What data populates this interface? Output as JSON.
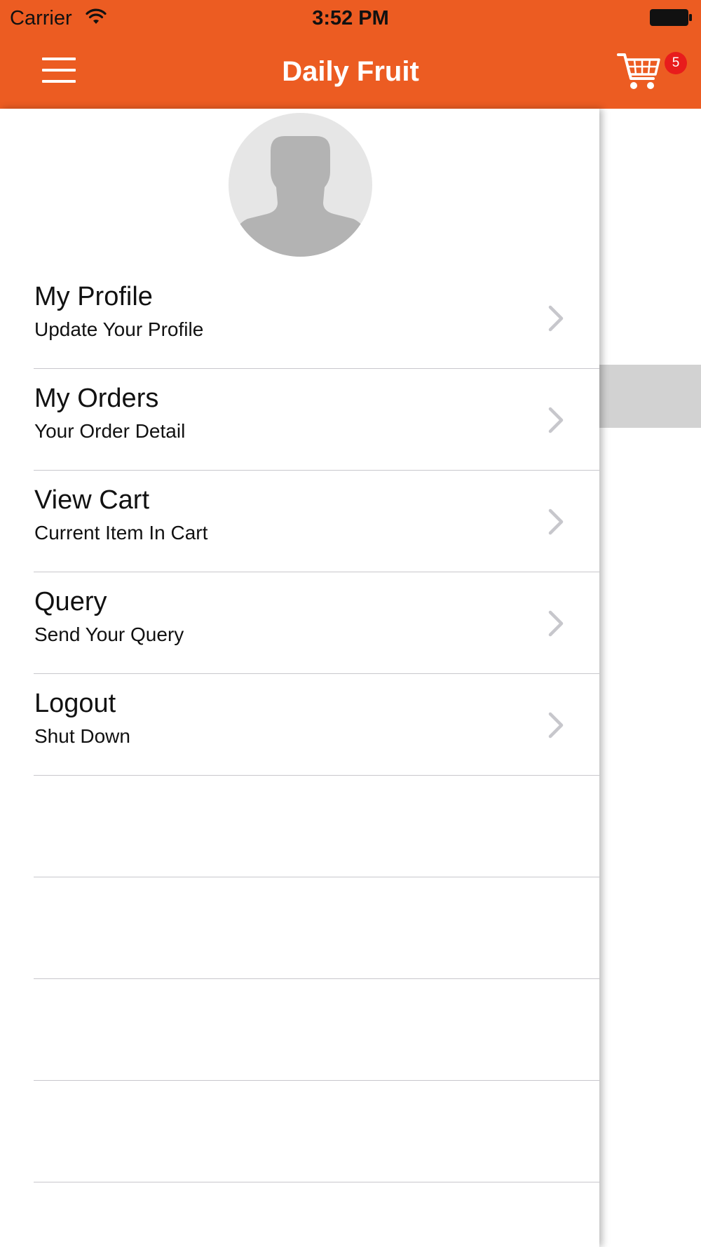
{
  "status_bar": {
    "carrier": "Carrier",
    "time": "3:52 PM",
    "wifi_icon": "wifi-icon",
    "battery_icon": "battery-icon"
  },
  "nav_bar": {
    "title": "Daily Fruit",
    "menu_icon": "hamburger-menu-icon",
    "cart_icon": "shopping-cart-icon",
    "cart_badge": "5",
    "background_color": "#EC5C22",
    "badge_color": "#E81C1C"
  },
  "drawer": {
    "avatar_icon": "user-silhouette-icon",
    "items": [
      {
        "title": "My Profile",
        "subtitle": "Update Your Profile",
        "icon": "chevron-right-icon"
      },
      {
        "title": "My Orders",
        "subtitle": "Your Order Detail",
        "icon": "chevron-right-icon"
      },
      {
        "title": "View Cart",
        "subtitle": "Current Item In Cart",
        "icon": "chevron-right-icon"
      },
      {
        "title": "Query",
        "subtitle": "Send Your Query",
        "icon": "chevron-right-icon"
      },
      {
        "title": "Logout",
        "subtitle": "Shut Down",
        "icon": "chevron-right-icon"
      }
    ]
  }
}
